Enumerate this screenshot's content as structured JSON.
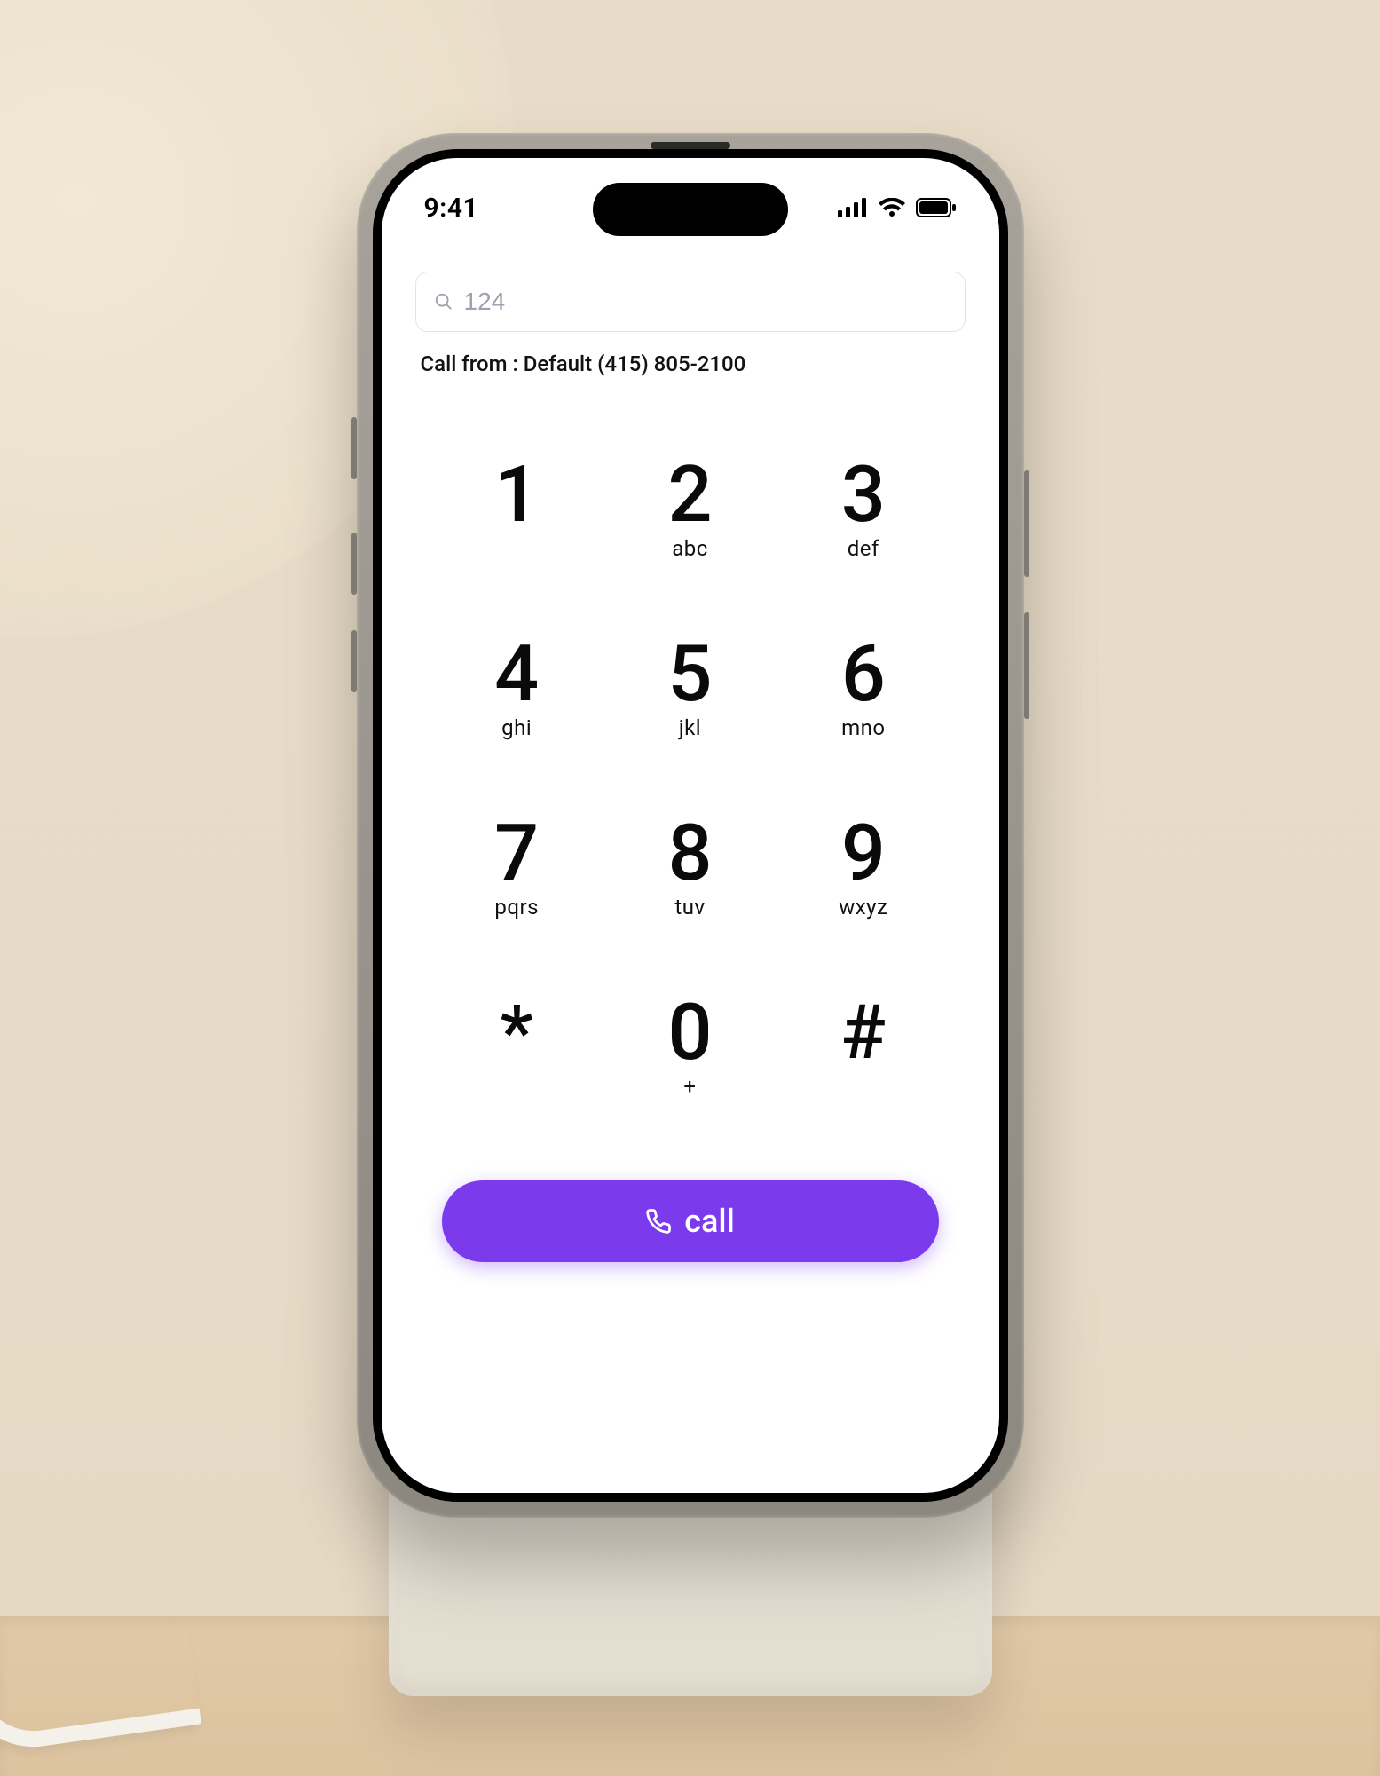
{
  "status": {
    "time": "9:41"
  },
  "search": {
    "value": "124"
  },
  "call_from": "Call from : Default (415) 805-2100",
  "keypad": [
    {
      "digit": "1",
      "letters": ""
    },
    {
      "digit": "2",
      "letters": "abc"
    },
    {
      "digit": "3",
      "letters": "def"
    },
    {
      "digit": "4",
      "letters": "ghi"
    },
    {
      "digit": "5",
      "letters": "jkl"
    },
    {
      "digit": "6",
      "letters": "mno"
    },
    {
      "digit": "7",
      "letters": "pqrs"
    },
    {
      "digit": "8",
      "letters": "tuv"
    },
    {
      "digit": "9",
      "letters": "wxyz"
    },
    {
      "digit": "*",
      "letters": ""
    },
    {
      "digit": "0",
      "letters": "+"
    },
    {
      "digit": "#",
      "letters": ""
    }
  ],
  "call_button": {
    "label": "call"
  },
  "colors": {
    "accent": "#7c3aed"
  }
}
